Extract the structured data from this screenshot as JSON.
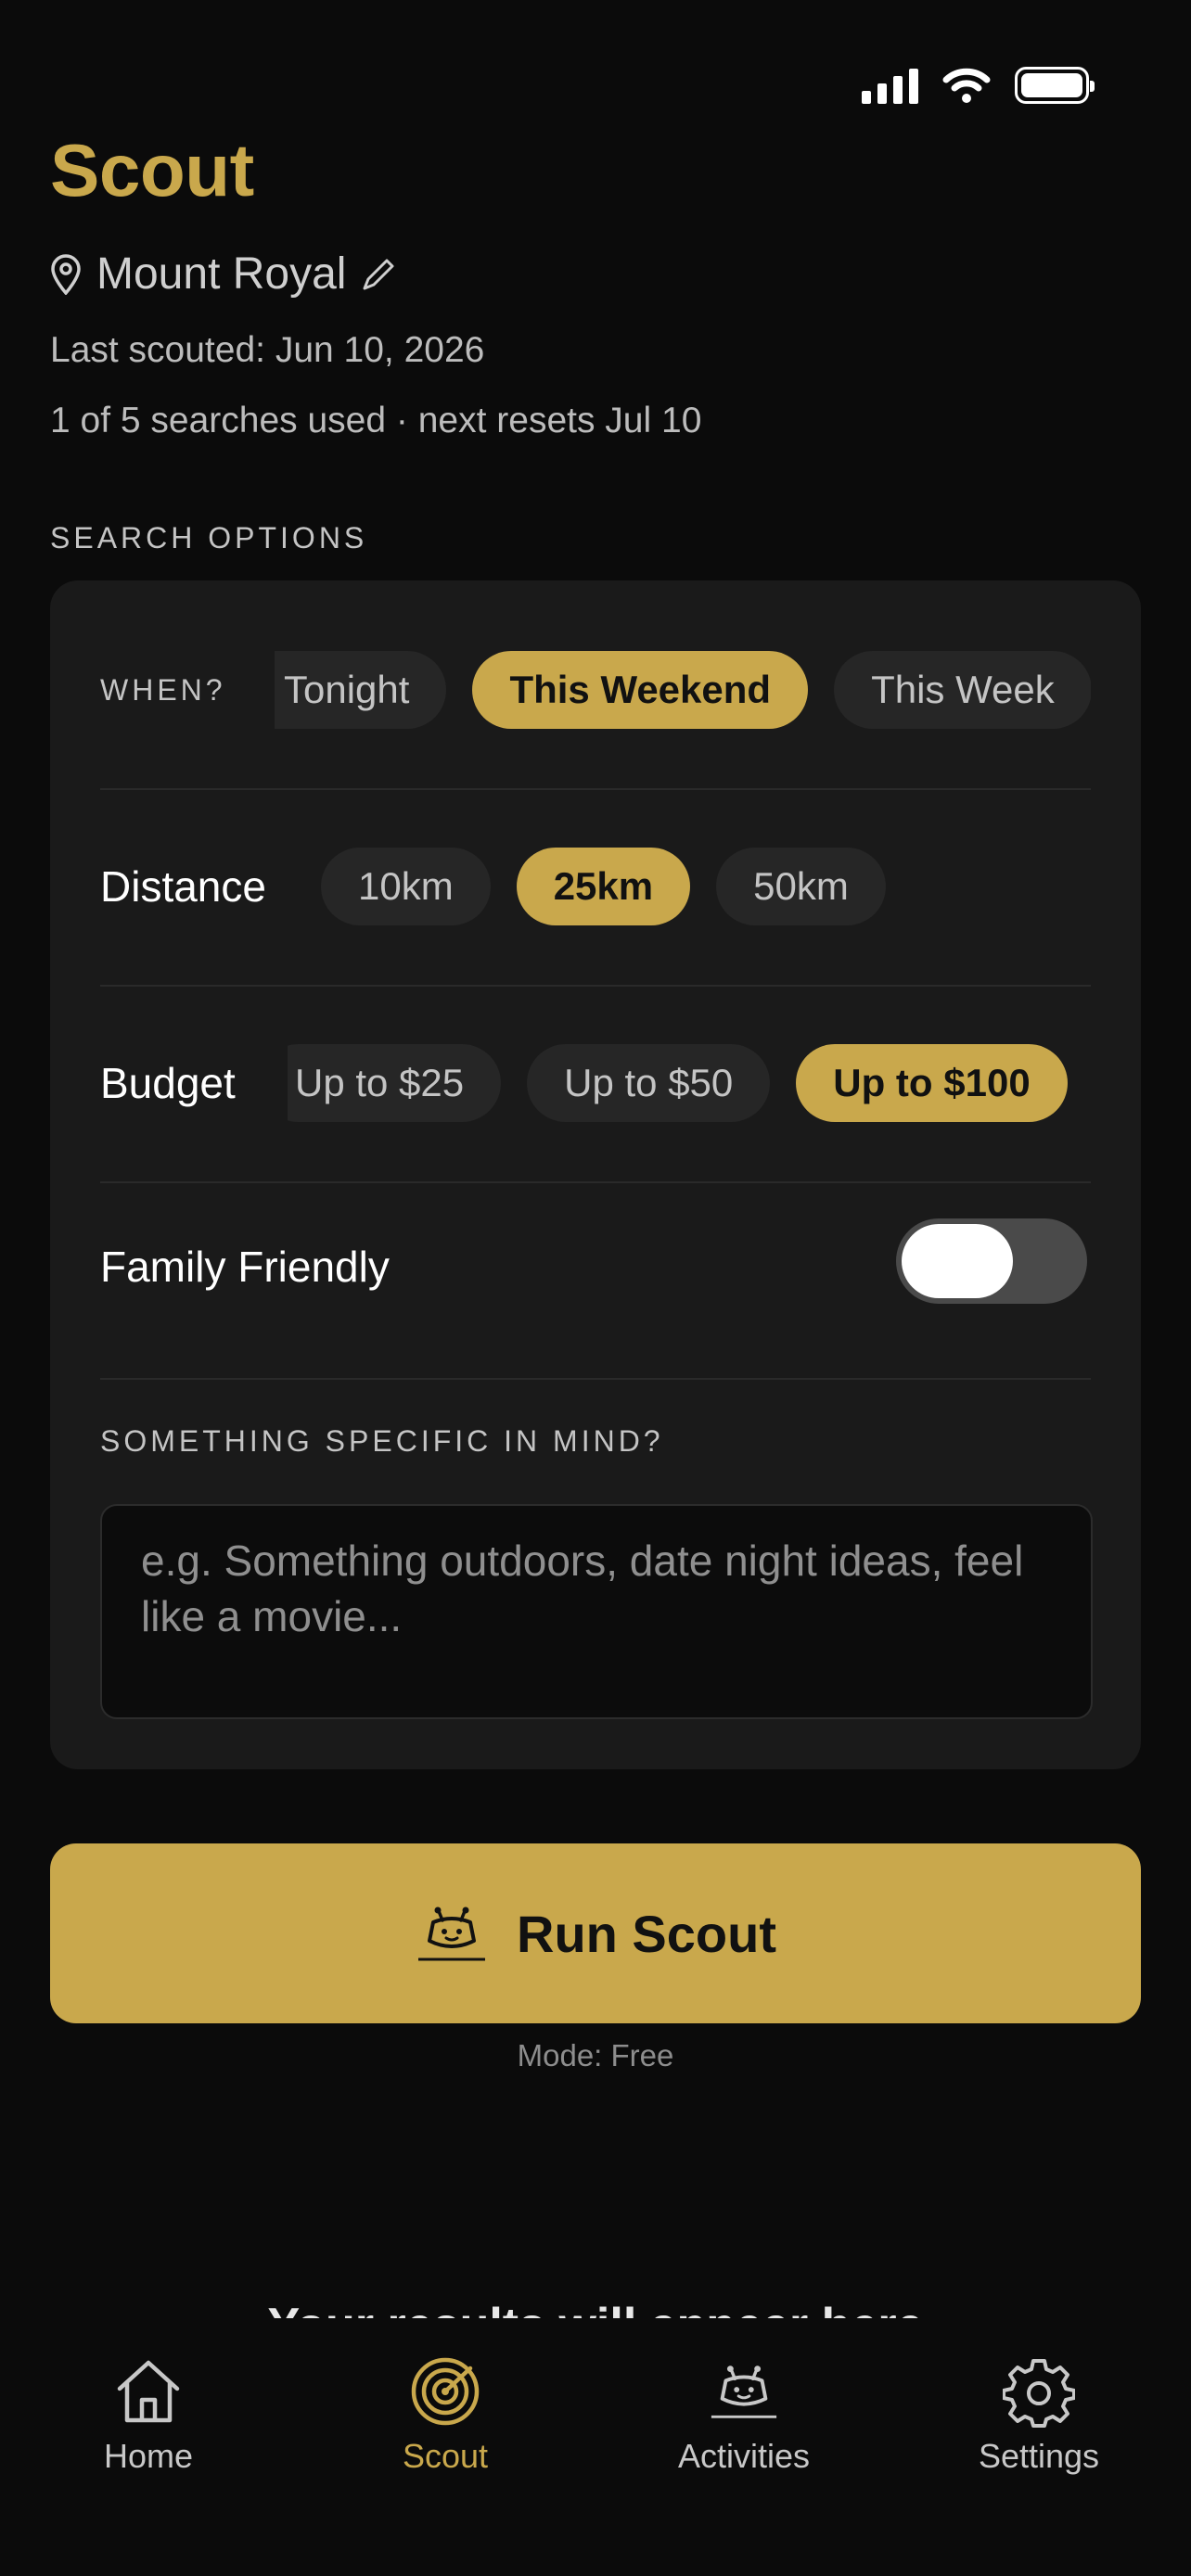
{
  "status_bar": {
    "icons": [
      "cellular-signal-icon",
      "wifi-icon",
      "battery-icon"
    ]
  },
  "header": {
    "title": "Scout",
    "location": "Mount Royal",
    "last_scouted": "Last scouted: Jun 10, 2026",
    "usage": "1 of 5 searches used · next resets Jul 10"
  },
  "search_options": {
    "section_label": "SEARCH OPTIONS",
    "when": {
      "label": "WHEN?",
      "options": [
        "Tonight",
        "This Weekend",
        "This Week"
      ],
      "selected": "This Weekend"
    },
    "distance": {
      "label": "Distance",
      "options": [
        "10km",
        "25km",
        "50km"
      ],
      "selected": "25km"
    },
    "budget": {
      "label": "Budget",
      "options": [
        "Up to $25",
        "Up to $50",
        "Up to $100"
      ],
      "selected": "Up to $100"
    },
    "family_friendly": {
      "label": "Family Friendly",
      "enabled": false
    },
    "specific": {
      "label": "SOMETHING SPECIFIC IN MIND?",
      "placeholder": "e.g. Something outdoors, date night ideas, feel like a movie...",
      "value": ""
    }
  },
  "run_button": {
    "label": "Run Scout",
    "mode": "Mode: Free"
  },
  "results": {
    "placeholder": "Your results will appear here"
  },
  "tab_bar": {
    "tabs": [
      {
        "label": "Home",
        "icon": "home-icon",
        "active": false
      },
      {
        "label": "Scout",
        "icon": "radar-icon",
        "active": true
      },
      {
        "label": "Activities",
        "icon": "robot-icon",
        "active": false
      },
      {
        "label": "Settings",
        "icon": "gear-icon",
        "active": false
      }
    ]
  },
  "colors": {
    "accent": "#c9a84c",
    "background": "#0b0b0b",
    "card": "#1a1a1a",
    "chip": "#262626"
  }
}
